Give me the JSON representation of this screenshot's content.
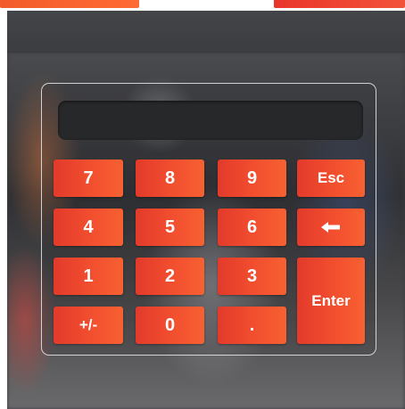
{
  "keypad": {
    "display_value": "",
    "keys": {
      "seven": "7",
      "eight": "8",
      "nine": "9",
      "esc": "Esc",
      "four": "4",
      "five": "5",
      "six": "6",
      "backspace_icon": "left-arrow-icon",
      "one": "1",
      "two": "2",
      "three": "3",
      "enter": "Enter",
      "plus_minus": "+/-",
      "zero": "0",
      "decimal": "."
    }
  },
  "colors": {
    "key_gradient_start": "#e33a2b",
    "key_gradient_end": "#f76131",
    "display_bg": "#27282a",
    "frame_bg": "#3b3d40"
  }
}
